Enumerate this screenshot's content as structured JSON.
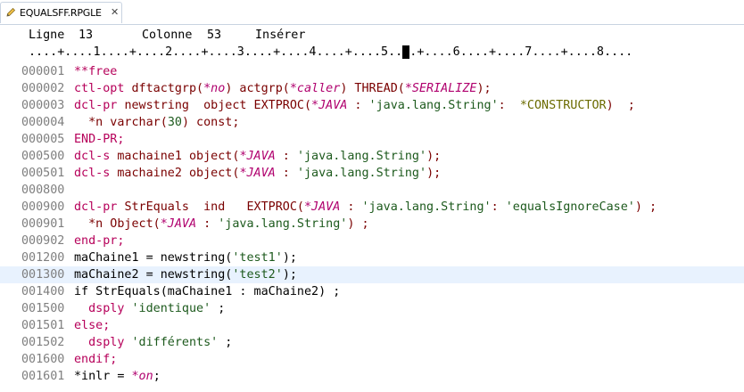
{
  "tab": {
    "label": "EQUALSFF.RPGLE",
    "close_glyph": "✕"
  },
  "status": {
    "line_label": "Ligne",
    "line_value": "13",
    "col_label": "Colonne",
    "col_value": "53",
    "mode": "Insérer"
  },
  "ruler": {
    "before": "....+....1....+....2....+....3....+....4....+....5..",
    "cursor": ".",
    "after": ".+....6....+....7....+....8...."
  },
  "lines": [
    {
      "num": "000001",
      "seg": [
        {
          "t": "**free",
          "c": "kw"
        }
      ]
    },
    {
      "num": "000002",
      "seg": [
        {
          "t": "ctl-opt ",
          "c": "kw"
        },
        {
          "t": "dftactgrp(",
          "c": "fn"
        },
        {
          "t": "*no",
          "c": "const"
        },
        {
          "t": ") actgrp(",
          "c": "fn"
        },
        {
          "t": "*caller",
          "c": "const"
        },
        {
          "t": ") THREAD(",
          "c": "fn"
        },
        {
          "t": "*SERIALIZE",
          "c": "const"
        },
        {
          "t": ");",
          "c": "fn"
        }
      ]
    },
    {
      "num": "000003",
      "seg": [
        {
          "t": "dcl-pr ",
          "c": "kw"
        },
        {
          "t": "newstring  object EXTPROC(",
          "c": "fn"
        },
        {
          "t": "*JAVA",
          "c": "const"
        },
        {
          "t": " : ",
          "c": "fn"
        },
        {
          "t": "'java.lang.String'",
          "c": "str"
        },
        {
          "t": ":  ",
          "c": "fn"
        },
        {
          "t": "*CONSTRUCTOR",
          "c": "str2"
        },
        {
          "t": ")  ;",
          "c": "fn"
        }
      ]
    },
    {
      "num": "000004",
      "seg": [
        {
          "t": "  *n varchar(",
          "c": "fn"
        },
        {
          "t": "30",
          "c": "str"
        },
        {
          "t": ") const;",
          "c": "fn"
        }
      ]
    },
    {
      "num": "000005",
      "seg": [
        {
          "t": "END-PR;",
          "c": "kw"
        }
      ]
    },
    {
      "num": "000500",
      "seg": [
        {
          "t": "dcl-s ",
          "c": "kw"
        },
        {
          "t": "machaine1 object(",
          "c": "fn"
        },
        {
          "t": "*JAVA",
          "c": "const"
        },
        {
          "t": " : ",
          "c": "fn"
        },
        {
          "t": "'java.lang.String'",
          "c": "str"
        },
        {
          "t": ");",
          "c": "fn"
        }
      ]
    },
    {
      "num": "000501",
      "seg": [
        {
          "t": "dcl-s ",
          "c": "kw"
        },
        {
          "t": "machaine2 object(",
          "c": "fn"
        },
        {
          "t": "*JAVA",
          "c": "const"
        },
        {
          "t": " : ",
          "c": "fn"
        },
        {
          "t": "'java.lang.String'",
          "c": "str"
        },
        {
          "t": ");",
          "c": "fn"
        }
      ]
    },
    {
      "num": "000800",
      "seg": []
    },
    {
      "num": "000900",
      "seg": [
        {
          "t": "dcl-pr ",
          "c": "kw"
        },
        {
          "t": "StrEquals  ind   EXTPROC(",
          "c": "fn"
        },
        {
          "t": "*JAVA",
          "c": "const"
        },
        {
          "t": " : ",
          "c": "fn"
        },
        {
          "t": "'java.lang.String'",
          "c": "str"
        },
        {
          "t": ": ",
          "c": "fn"
        },
        {
          "t": "'equalsIgnoreCase'",
          "c": "str"
        },
        {
          "t": ") ;",
          "c": "fn"
        }
      ]
    },
    {
      "num": "000901",
      "seg": [
        {
          "t": "  *n Object(",
          "c": "fn"
        },
        {
          "t": "*JAVA",
          "c": "const"
        },
        {
          "t": " : ",
          "c": "fn"
        },
        {
          "t": "'java.lang.String'",
          "c": "str"
        },
        {
          "t": ") ;",
          "c": "fn"
        }
      ]
    },
    {
      "num": "000902",
      "seg": [
        {
          "t": "end-pr;",
          "c": "kw"
        }
      ]
    },
    {
      "num": "001200",
      "seg": [
        {
          "t": "maChaine1 = newstring(",
          "c": "var"
        },
        {
          "t": "'test1'",
          "c": "str"
        },
        {
          "t": ");",
          "c": "var"
        }
      ]
    },
    {
      "num": "001300",
      "current": true,
      "seg": [
        {
          "t": "maChaine2 = newstring(",
          "c": "var"
        },
        {
          "t": "'test2'",
          "c": "str"
        },
        {
          "t": ");",
          "c": "var"
        }
      ]
    },
    {
      "num": "001400",
      "seg": [
        {
          "t": "if StrEquals(maChaine1 : maChaine2) ;",
          "c": "var"
        }
      ]
    },
    {
      "num": "001500",
      "seg": [
        {
          "t": "  dsply ",
          "c": "kw"
        },
        {
          "t": "'identique'",
          "c": "str"
        },
        {
          "t": " ;",
          "c": "var"
        }
      ]
    },
    {
      "num": "001501",
      "seg": [
        {
          "t": "else;",
          "c": "kw"
        }
      ]
    },
    {
      "num": "001502",
      "seg": [
        {
          "t": "  dsply ",
          "c": "kw"
        },
        {
          "t": "'différents'",
          "c": "str"
        },
        {
          "t": " ;",
          "c": "var"
        }
      ]
    },
    {
      "num": "001600",
      "seg": [
        {
          "t": "endif;",
          "c": "kw"
        }
      ]
    },
    {
      "num": "001601",
      "seg": [
        {
          "t": "*inlr = ",
          "c": "var"
        },
        {
          "t": "*on",
          "c": "const"
        },
        {
          "t": ";",
          "c": "var"
        }
      ]
    }
  ]
}
